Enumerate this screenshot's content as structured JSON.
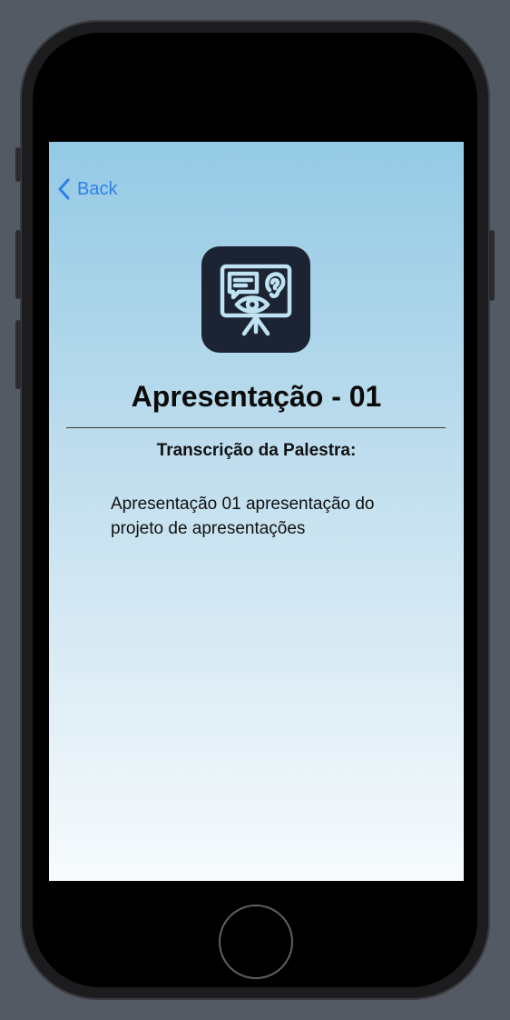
{
  "nav": {
    "back_label": "Back"
  },
  "presentation": {
    "title": "Apresentação - 01",
    "transcript_heading": "Transcrição da Palestra:",
    "transcript_text": "Apresentação 01 apresentação do projeto de apresentações"
  },
  "icons": {
    "back": "chevron-left-icon",
    "app": "presentation-board-icon",
    "home": "home-button"
  },
  "colors": {
    "accent": "#2f7fe9",
    "gradient_top": "#94cae5",
    "gradient_bottom": "#f7fbfd",
    "icon_background": "#1c2433",
    "icon_stroke": "#bfe3f2"
  }
}
